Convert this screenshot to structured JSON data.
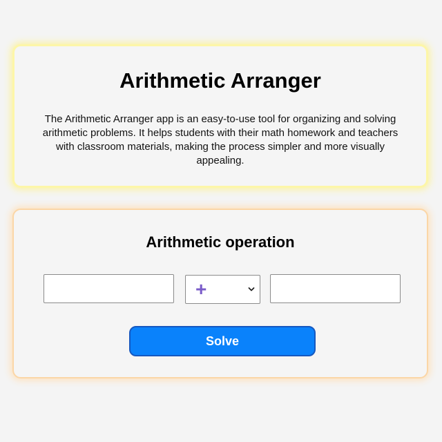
{
  "intro": {
    "title": "Arithmetic Arranger",
    "description": "The Arithmetic Arranger app is an easy-to-use tool for organizing and solving arithmetic problems. It helps students with their math homework and teachers with classroom materials, making the process simpler and more visually appealing."
  },
  "operation": {
    "title": "Arithmetic operation",
    "operand_a": {
      "value": "",
      "placeholder": ""
    },
    "operator": {
      "selected": "+",
      "icon": "chevron-down-icon"
    },
    "operand_b": {
      "value": "",
      "placeholder": ""
    },
    "solve_label": "Solve"
  },
  "colors": {
    "accent": "#0a82fb",
    "operator": "#7a5cc9",
    "intro_glow": "#fdf6a8",
    "operation_glow": "#fbd6a6"
  }
}
